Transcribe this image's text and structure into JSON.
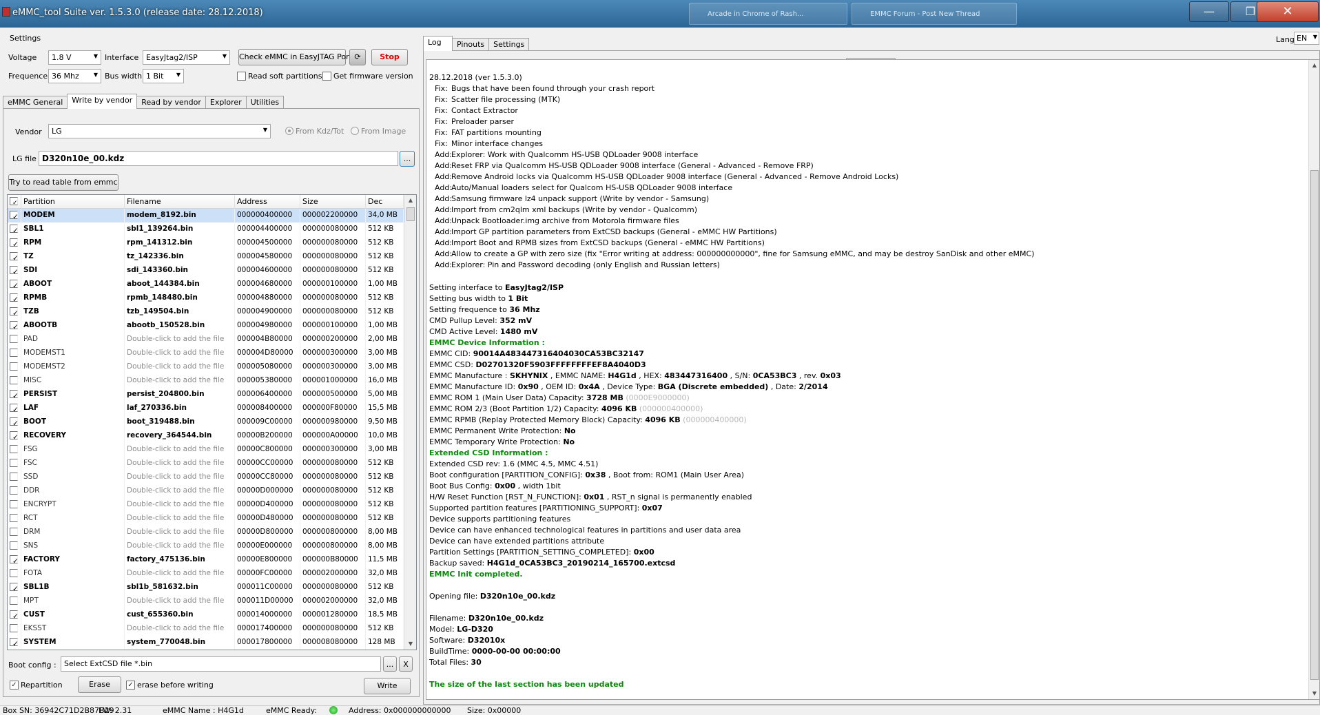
{
  "window": {
    "title": "eMMC_tool Suite  ver. 1.5.3.0 (release date: 28.12.2018)",
    "taskbar_items": [
      "Arcade in Chrome of Rash...",
      "EMMC Forum - Post New Thread"
    ],
    "min": "—",
    "max": "❐",
    "close": "✕"
  },
  "settings": {
    "group_label": "Settings",
    "voltage_label": "Voltage",
    "voltage_value": "1.8 V",
    "interface_label": "Interface",
    "interface_value": "EasyJtag2/ISP",
    "frequence_label": "Frequence",
    "frequence_value": "36 Mhz",
    "buswidth_label": "Bus width",
    "buswidth_value": "1 Bit",
    "check_button": "Check eMMC in EasyJTAG Port",
    "stop_button": "Stop",
    "read_soft_partitions": "Read soft partitions",
    "get_firmware_version": "Get firmware version"
  },
  "left_tabs": [
    "eMMC General",
    "Write by vendor",
    "Read by vendor",
    "Explorer",
    "Utilities"
  ],
  "vendor": {
    "label": "Vendor",
    "value": "LG",
    "from_kdz": "From Kdz/Tot",
    "from_image": "From Image",
    "lgfile_label": "LG file",
    "lgfile_value": "D320n10e_00.kdz",
    "browse": "...",
    "read_table_button": "Try to read table from emmc"
  },
  "table": {
    "headers": [
      "Partition",
      "Filename",
      "Address",
      "Size",
      "Dec"
    ],
    "rows": [
      {
        "on": true,
        "p": "MODEM",
        "f": "modem_8192.bin",
        "a": "000000400000",
        "s": "000002200000",
        "d": "34,0 MB"
      },
      {
        "on": true,
        "p": "SBL1",
        "f": "sbl1_139264.bin",
        "a": "000004400000",
        "s": "000000080000",
        "d": "512 KB"
      },
      {
        "on": true,
        "p": "RPM",
        "f": "rpm_141312.bin",
        "a": "000004500000",
        "s": "000000080000",
        "d": "512 KB"
      },
      {
        "on": true,
        "p": "TZ",
        "f": "tz_142336.bin",
        "a": "000004580000",
        "s": "000000080000",
        "d": "512 KB"
      },
      {
        "on": true,
        "p": "SDI",
        "f": "sdi_143360.bin",
        "a": "000004600000",
        "s": "000000080000",
        "d": "512 KB"
      },
      {
        "on": true,
        "p": "ABOOT",
        "f": "aboot_144384.bin",
        "a": "000004680000",
        "s": "000000100000",
        "d": "1,00 MB"
      },
      {
        "on": true,
        "p": "RPMB",
        "f": "rpmb_148480.bin",
        "a": "000004880000",
        "s": "000000080000",
        "d": "512 KB"
      },
      {
        "on": true,
        "p": "TZB",
        "f": "tzb_149504.bin",
        "a": "000004900000",
        "s": "000000080000",
        "d": "512 KB"
      },
      {
        "on": true,
        "p": "ABOOTB",
        "f": "abootb_150528.bin",
        "a": "000004980000",
        "s": "000000100000",
        "d": "1,00 MB"
      },
      {
        "on": false,
        "p": "PAD",
        "f": "Double-click to add the file",
        "a": "000004B80000",
        "s": "000000200000",
        "d": "2,00 MB"
      },
      {
        "on": false,
        "p": "MODEMST1",
        "f": "Double-click to add the file",
        "a": "000004D80000",
        "s": "000000300000",
        "d": "3,00 MB"
      },
      {
        "on": false,
        "p": "MODEMST2",
        "f": "Double-click to add the file",
        "a": "000005080000",
        "s": "000000300000",
        "d": "3,00 MB"
      },
      {
        "on": false,
        "p": "MISC",
        "f": "Double-click to add the file",
        "a": "000005380000",
        "s": "000001000000",
        "d": "16,0 MB"
      },
      {
        "on": true,
        "p": "PERSIST",
        "f": "persist_204800.bin",
        "a": "000006400000",
        "s": "000000500000",
        "d": "5,00 MB"
      },
      {
        "on": true,
        "p": "LAF",
        "f": "laf_270336.bin",
        "a": "000008400000",
        "s": "000000F80000",
        "d": "15,5 MB"
      },
      {
        "on": true,
        "p": "BOOT",
        "f": "boot_319488.bin",
        "a": "000009C00000",
        "s": "000000980000",
        "d": "9,50 MB"
      },
      {
        "on": true,
        "p": "RECOVERY",
        "f": "recovery_364544.bin",
        "a": "00000B200000",
        "s": "000000A00000",
        "d": "10,0 MB"
      },
      {
        "on": false,
        "p": "FSG",
        "f": "Double-click to add the file",
        "a": "00000C800000",
        "s": "000000300000",
        "d": "3,00 MB"
      },
      {
        "on": false,
        "p": "FSC",
        "f": "Double-click to add the file",
        "a": "00000CC00000",
        "s": "000000080000",
        "d": "512 KB"
      },
      {
        "on": false,
        "p": "SSD",
        "f": "Double-click to add the file",
        "a": "00000CC80000",
        "s": "000000080000",
        "d": "512 KB"
      },
      {
        "on": false,
        "p": "DDR",
        "f": "Double-click to add the file",
        "a": "00000D000000",
        "s": "000000080000",
        "d": "512 KB"
      },
      {
        "on": false,
        "p": "ENCRYPT",
        "f": "Double-click to add the file",
        "a": "00000D400000",
        "s": "000000080000",
        "d": "512 KB"
      },
      {
        "on": false,
        "p": "RCT",
        "f": "Double-click to add the file",
        "a": "00000D480000",
        "s": "000000080000",
        "d": "512 KB"
      },
      {
        "on": false,
        "p": "DRM",
        "f": "Double-click to add the file",
        "a": "00000D800000",
        "s": "000000800000",
        "d": "8,00 MB"
      },
      {
        "on": false,
        "p": "SNS",
        "f": "Double-click to add the file",
        "a": "00000E000000",
        "s": "000000800000",
        "d": "8,00 MB"
      },
      {
        "on": true,
        "p": "FACTORY",
        "f": "factory_475136.bin",
        "a": "00000E800000",
        "s": "000000B80000",
        "d": "11,5 MB"
      },
      {
        "on": false,
        "p": "FOTA",
        "f": "Double-click to add the file",
        "a": "00000FC00000",
        "s": "000002000000",
        "d": "32,0 MB"
      },
      {
        "on": true,
        "p": "SBL1B",
        "f": "sbl1b_581632.bin",
        "a": "000011C00000",
        "s": "000000080000",
        "d": "512 KB"
      },
      {
        "on": false,
        "p": "MPT",
        "f": "Double-click to add the file",
        "a": "000011D00000",
        "s": "000002000000",
        "d": "32,0 MB"
      },
      {
        "on": true,
        "p": "CUST",
        "f": "cust_655360.bin",
        "a": "000014000000",
        "s": "000001280000",
        "d": "18,5 MB"
      },
      {
        "on": false,
        "p": "EKSST",
        "f": "Double-click to add the file",
        "a": "000017400000",
        "s": "000000080000",
        "d": "512 KB"
      },
      {
        "on": true,
        "p": "SYSTEM",
        "f": "system_770048.bin",
        "a": "000017800000",
        "s": "000008080000",
        "d": "128 MB"
      }
    ]
  },
  "bottom": {
    "bootconfig_label": "Boot config :",
    "bootconfig_value": "Select ExtCSD file *.bin",
    "browse": "...",
    "clear": "X",
    "repartition": "Repartition",
    "erase_button": "Erase",
    "erase_before_writing": "erase before writing",
    "write_button": "Write"
  },
  "right_tabs": [
    "Log",
    "Pinouts",
    "Settings"
  ],
  "lang": {
    "label": "Lang",
    "value": "EN"
  },
  "log": {
    "version_line": "28.12.2018 (ver 1.5.3.0)",
    "changes": [
      [
        "Fix:",
        "Bugs that have been found through your crash report"
      ],
      [
        "Fix:",
        "Scatter file processing (MTK)"
      ],
      [
        "Fix:",
        "Contact Extractor"
      ],
      [
        "Fix:",
        "Preloader parser"
      ],
      [
        "Fix:",
        "FAT partitions mounting"
      ],
      [
        "Fix:",
        "Minor interface changes"
      ],
      [
        "Add:",
        "Explorer: Work with Qualcomm HS-USB QDLoader 9008 interface"
      ],
      [
        "Add:",
        "Reset FRP via Qualcomm HS-USB QDLoader 9008 interface (General - Advanced - Remove FRP)"
      ],
      [
        "Add:",
        "Remove Android locks via Qualcomm HS-USB QDLoader 9008 interface  (General - Advanced - Remove Android Locks)"
      ],
      [
        "Add:",
        "Auto/Manual loaders select for Qualcom HS-USB QDLoader 9008 interface"
      ],
      [
        "Add:",
        "Samsung firmware lz4 unpack support (Write by vendor - Samsung)"
      ],
      [
        "Add:",
        "Import from cm2qlm xml backups (Write by vendor - Qualcomm)"
      ],
      [
        "Add:",
        "Unpack Bootloader.img archive from Motorola firmware files"
      ],
      [
        "Add:",
        "Import GP partition parameters from ExtCSD backups (General - eMMC HW Partitions)"
      ],
      [
        "Add:",
        "Import Boot and RPMB sizes from ExtCSD backups (General - eMMC HW Partitions)"
      ],
      [
        "Add:",
        "Allow to create a GP with zero size (fix \"Error writing at address: 000000000000\", fine for Samsung eMMC, and may be destroy SanDisk and other eMMC)"
      ],
      [
        "Add:",
        "Explorer: Pin and Password decoding (only English and Russian letters)"
      ]
    ],
    "set_interface": [
      "Setting interface to ",
      "EasyJtag2/ISP"
    ],
    "set_bus": [
      "Setting bus width to ",
      "1 Bit"
    ],
    "set_freq": [
      "Setting frequence to ",
      "36 Mhz"
    ],
    "cmd_pullup": [
      "CMD Pullup Level: ",
      "352  mV"
    ],
    "cmd_active": [
      "CMD Active Level: ",
      "1480  mV"
    ],
    "device_info_heading": "EMMC Device Information :",
    "cid": [
      "EMMC CID: ",
      "90014A483447316404030CA53BC32147"
    ],
    "csd": [
      "EMMC CSD: ",
      "D02701320F5903FFFFFFFFEF8A4040D3"
    ],
    "manufacture_parts": [
      "EMMC Manufacture : ",
      "SKHYNIX",
      " , EMMC NAME: ",
      "H4G1d",
      " , HEX: ",
      "483447316400",
      " , S/N: ",
      "0CA53BC3",
      " , rev. ",
      "0x03"
    ],
    "manufacture_id_parts": [
      "EMMC Manufacture ID: ",
      "0x90",
      " , OEM ID: ",
      "0x4A",
      " , Device Type: ",
      "BGA (Discrete embedded)",
      " , Date: ",
      "2/2014"
    ],
    "rom1": [
      "EMMC ROM 1 (Main User Data) Capacity: ",
      "3728 MB",
      " (0000E9000000)"
    ],
    "rom23": [
      "EMMC ROM 2/3 (Boot Partition 1/2) Capacity: ",
      "4096 KB",
      " (000000400000)"
    ],
    "rpmb": [
      "EMMC RPMB (Replay Protected Memory Block) Capacity: ",
      "4096 KB",
      " (000000400000)"
    ],
    "perm_wp": [
      "EMMC Permanent Write Protection: ",
      "No"
    ],
    "temp_wp": [
      "EMMC Temporary Write Protection: ",
      "No"
    ],
    "ext_csd_heading": "Extended CSD Information :",
    "ext_rev": "Extended CSD rev: 1.6 (MMC 4.5, MMC 4.51)",
    "boot_cfg": [
      "Boot configuration [PARTITION_CONFIG]: ",
      "0x38",
      " , Boot from: ROM1 (Main User Area)"
    ],
    "boot_bus": [
      "Boot Bus Config: ",
      "0x00",
      " , width 1bit"
    ],
    "hw_reset": [
      "H/W Reset Function [RST_N_FUNCTION]: ",
      "0x01",
      " , RST_n signal is permanently enabled"
    ],
    "part_support": [
      "Supported partition features [PARTITIONING_SUPPORT]: ",
      "0x07"
    ],
    "dev_supports": "Device supports partitioning features",
    "enh_features": "Device can have enhanced technological features in partitions and user data area",
    "ext_attr": "Device can have extended partitions attribute",
    "part_settings": [
      "Partition Settings [PARTITION_SETTING_COMPLETED]: ",
      "0x00"
    ],
    "backup_saved": [
      "Backup saved: ",
      "H4G1d_0CA53BC3_20190214_165700.extcsd"
    ],
    "init_completed": "EMMC Init completed.",
    "opening": [
      "Opening file: ",
      "D320n10e_00.kdz"
    ],
    "filename": [
      "Filename: ",
      "D320n10e_00.kdz"
    ],
    "model": [
      "Model: ",
      "LG-D320"
    ],
    "software": [
      "Software: ",
      "D32010x"
    ],
    "buildtime": [
      "BuildTime: ",
      "0000-00-00 00:00:00"
    ],
    "totalfiles": [
      "Total Files: ",
      "30"
    ],
    "last_section": "The size of the last section has been updated"
  },
  "status": {
    "box_sn": "Box SN:  36942C71D2B87B29",
    "fw": "FW:   2.31",
    "emmc_name": "eMMC Name : H4G1d",
    "emmc_ready": "eMMC Ready:",
    "address": "Address: 0x000000000000",
    "size": "Size: 0x00000"
  },
  "colors": {
    "green_text": "#0a8a0a",
    "stop_text": "#e00000",
    "selection": "#cce0f7"
  }
}
